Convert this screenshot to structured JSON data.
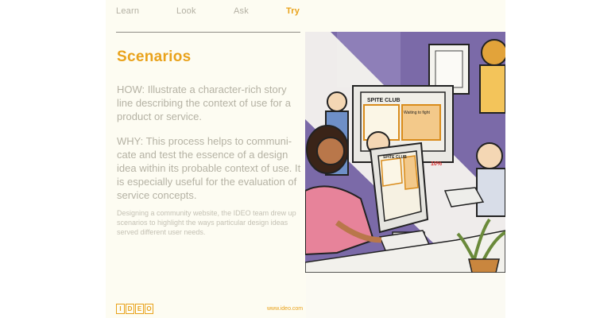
{
  "nav": {
    "tabs": [
      {
        "label": "Learn",
        "active": false
      },
      {
        "label": "Look",
        "active": false
      },
      {
        "label": "Ask",
        "active": false
      },
      {
        "label": "Try",
        "active": true
      }
    ]
  },
  "content": {
    "title": "Scenarios",
    "how": "HOW: Illustrate a character-rich story line describing the context of use for a product or service.",
    "why": "WHY: This process helps to communi-cate and test the essence of a design idea within its probable context of use. It is especially useful for the evaluation of service concepts.",
    "caption": "Designing a community website, the IDEO team drew up scenarios to highlight the ways particular design ideas served different user needs."
  },
  "illustration": {
    "screen_title_back": "SPITE CLUB",
    "screen_subtitle": "Waiting to fight",
    "screen_title_front": "SPITE CLUB",
    "percent": "10%"
  },
  "footer": {
    "logo_letters": [
      "I",
      "D",
      "E",
      "O"
    ],
    "url": "www.ideo.com"
  },
  "colors": {
    "accent": "#e9a21b",
    "card_background": "#fdfcf2",
    "wall_purple": "#7b6aa8"
  }
}
